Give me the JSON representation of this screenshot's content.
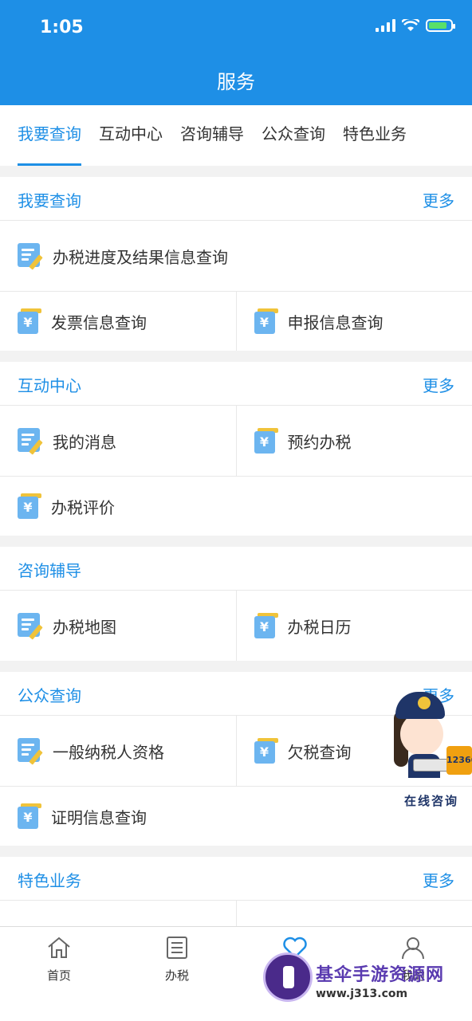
{
  "status": {
    "time": "1:05"
  },
  "header": {
    "title": "服务"
  },
  "tabs": [
    "我要查询",
    "互动中心",
    "咨询辅导",
    "公众查询",
    "特色业务"
  ],
  "sections": {
    "query": {
      "title": "我要查询",
      "more": "更多",
      "items": [
        "办税进度及结果信息查询",
        "发票信息查询",
        "申报信息查询"
      ]
    },
    "interact": {
      "title": "互动中心",
      "more": "更多",
      "items": [
        "我的消息",
        "预约办税",
        "办税评价"
      ]
    },
    "consult": {
      "title": "咨询辅导",
      "items": [
        "办税地图",
        "办税日历"
      ]
    },
    "public": {
      "title": "公众查询",
      "more": "更多",
      "items": [
        "一般纳税人资格",
        "欠税查询",
        "证明信息查询"
      ]
    },
    "special": {
      "title": "特色业务",
      "more": "更多"
    }
  },
  "tabbar": [
    "首页",
    "办税",
    "",
    "我的"
  ],
  "mascot": {
    "caption": "在线咨询",
    "card": "12366"
  },
  "watermark": {
    "name": "基伞手游资源网",
    "url": "www.j313.com"
  },
  "colors": {
    "primary": "#1e8fe6",
    "icon_blue": "#6cb5f0",
    "icon_yellow": "#f0c33a"
  }
}
